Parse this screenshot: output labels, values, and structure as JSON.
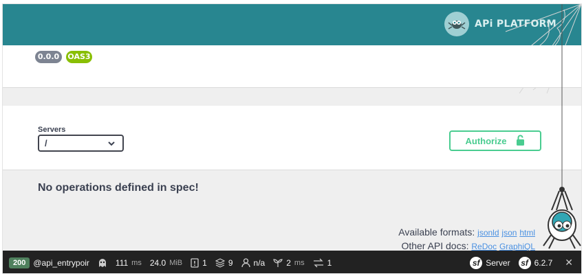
{
  "header": {
    "logo_text": "APi PLATFORM"
  },
  "info": {
    "version": "0.0.0",
    "spec": "OAS3"
  },
  "servers": {
    "label": "Servers",
    "selected": "/"
  },
  "authorize": {
    "label": "Authorize"
  },
  "operations": {
    "empty_message": "No operations defined in spec!"
  },
  "formats": {
    "available_label": "Available formats:",
    "links": [
      "jsonld",
      "json",
      "html"
    ],
    "other_label": "Other API docs:",
    "other_links": [
      "ReDoc",
      "GraphiQL"
    ]
  },
  "toolbar": {
    "status": "200",
    "route": "@api_entrypoir",
    "time": "111",
    "time_unit": "ms",
    "memory": "24.0",
    "memory_unit": "MiB",
    "logs": "1",
    "cache": "9",
    "user": "n/a",
    "twig": "2",
    "twig_unit": "ms",
    "requests": "1",
    "server_label": "Server",
    "version": "6.2.7",
    "close": "✕"
  },
  "colors": {
    "header": "#288690",
    "authorize": "#49cc90",
    "link": "#4990e2",
    "toolbar": "#222222",
    "status_ok": "#4f805d"
  }
}
